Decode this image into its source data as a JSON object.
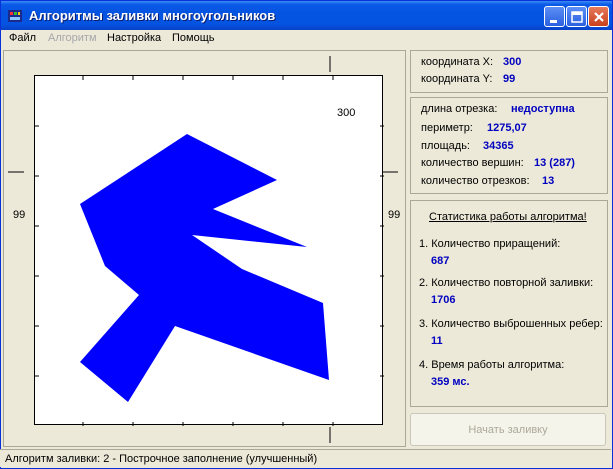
{
  "window": {
    "title": "Алгоритмы заливки многоугольников"
  },
  "menu": [
    "Файл",
    "Алгоритм",
    "Настройка",
    "Помощь"
  ],
  "canvas": {
    "coord_top": "300",
    "coord_bottom": "300",
    "coord_left": "99",
    "coord_right": "99",
    "fill_color": "#0000ff"
  },
  "coords": {
    "x_label": "координата X:",
    "x_value": "300",
    "y_label": "координата Y:",
    "y_value": "99"
  },
  "metrics": {
    "length_label": "длина отрезка:",
    "length_value": "недоступна",
    "perimeter_label": "периметр:",
    "perimeter_value": "1275,07",
    "area_label": "площадь:",
    "area_value": "34365",
    "vertices_label": "количество вершин:",
    "vertices_value": "13 (287)",
    "segments_label": "количество отрезков:",
    "segments_value": "13"
  },
  "stats": {
    "title": "Статистика работы алгоритма!",
    "items": [
      {
        "label": "1. Количество приращений:",
        "value": "687"
      },
      {
        "label": "2. Количество повторной заливки:",
        "value": "1706"
      },
      {
        "label": "3. Количество выброшенных ребер:",
        "value": "11"
      },
      {
        "label": "4. Время работы алгоритма:",
        "value": "359 мс."
      }
    ]
  },
  "start_button": "Начать заливку",
  "status": "Алгоритм заливки: 2 - Построчное заполнение (улучшенный)"
}
